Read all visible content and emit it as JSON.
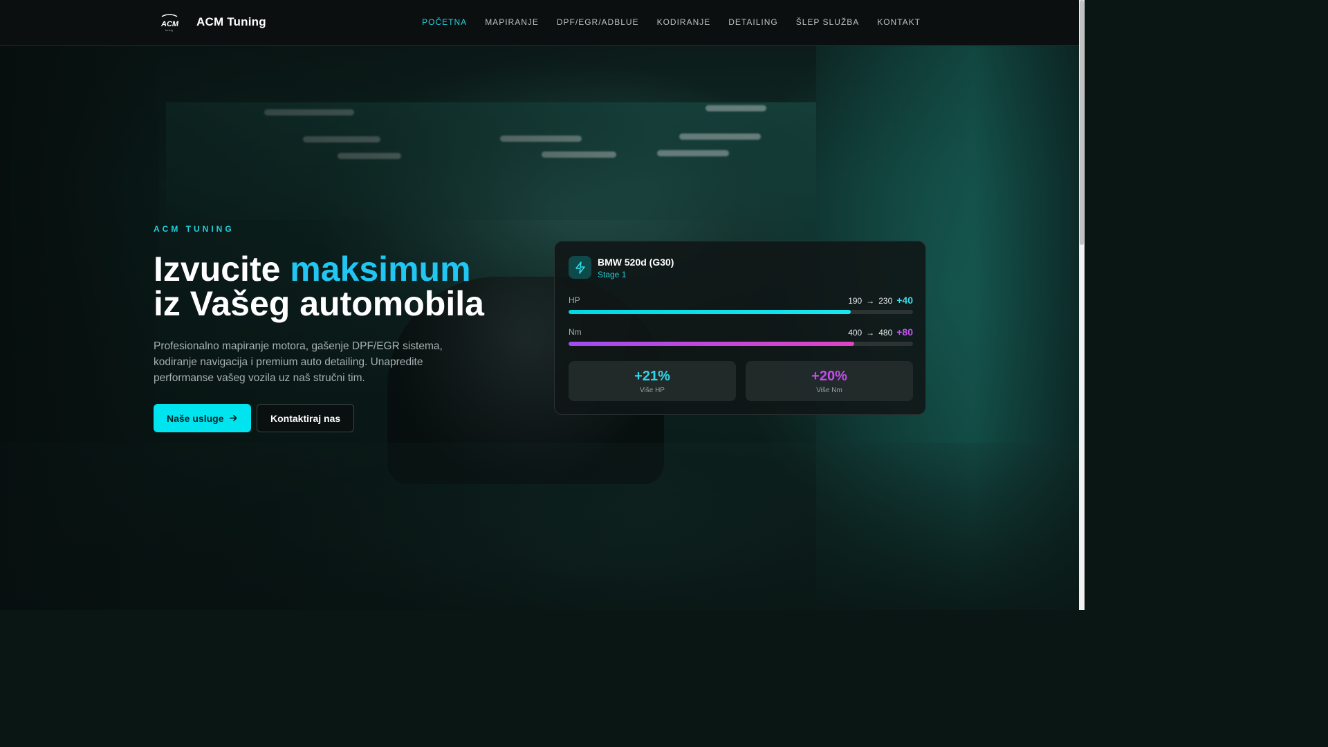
{
  "header": {
    "brand": "ACM Tuning",
    "logo_text": "ACM",
    "logo_subtext": "tuning",
    "nav": [
      {
        "label": "POČETNA",
        "active": true
      },
      {
        "label": "MAPIRANJE",
        "active": false
      },
      {
        "label": "DPF/EGR/ADBLUE",
        "active": false
      },
      {
        "label": "KODIRANJE",
        "active": false
      },
      {
        "label": "DETAILING",
        "active": false
      },
      {
        "label": "ŠLEP SLUŽBA",
        "active": false
      },
      {
        "label": "KONTAKT",
        "active": false
      }
    ]
  },
  "hero": {
    "eyebrow": "ACM TUNING",
    "headline_part1": "Izvucite ",
    "headline_accent": "maksimum",
    "headline_line2": "iz Vašeg automobila",
    "lead": "Profesionalno mapiranje motora, gašenje DPF/EGR sistema, kodiranje navigacija i premium auto detailing. Unapredite performanse vašeg vozila uz naš stručni tim.",
    "primary_button": "Naše usluge",
    "primary_button_icon": "arrow-right-icon",
    "secondary_button": "Kontaktiraj nas"
  },
  "card": {
    "icon": "lightning-icon",
    "car": "BMW 520d (G30)",
    "stage": "Stage 1",
    "metrics": [
      {
        "label": "HP",
        "from": "190",
        "arrow": "→",
        "to": "230",
        "gain": "+40",
        "fill": 0.82
      },
      {
        "label": "Nm",
        "from": "400",
        "arrow": "→",
        "to": "480",
        "gain": "+80",
        "fill": 0.83
      }
    ],
    "stats": [
      {
        "value": "+21%",
        "caption": "Više HP"
      },
      {
        "value": "+20%",
        "caption": "Više Nm"
      }
    ]
  },
  "colors": {
    "accent": "#00e4ef",
    "nav_active": "#23d3df",
    "headline_accent": "#22c6f2",
    "hp_gain": "#2fe0ee",
    "nm_gain": "#c650f0",
    "hp_bar_start": "#00d8e6",
    "hp_bar_end": "#19e6f0",
    "nm_bar_start": "#a24cf2",
    "nm_bar_end": "#e143c4",
    "stat_hp": "#2ed8ea",
    "stat_nm": "#c34df0"
  }
}
